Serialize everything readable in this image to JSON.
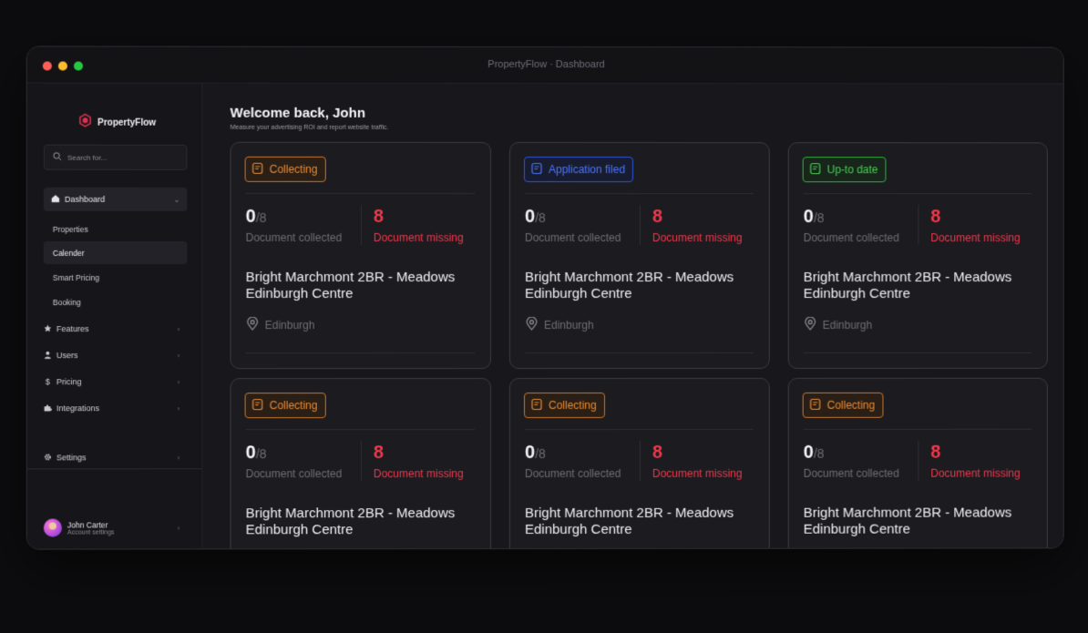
{
  "window": {
    "title": "PropertyFlow · Dashboard"
  },
  "sidebar": {
    "brand": "PropertyFlow",
    "search_placeholder": "Search for...",
    "dashboard_label": "Dashboard",
    "sub_items": [
      {
        "label": "Properties"
      },
      {
        "label": "Calender",
        "active": true
      },
      {
        "label": "Smart Pricing"
      },
      {
        "label": "Booking"
      }
    ],
    "nav_items": [
      {
        "label": "Features",
        "icon": "star-icon"
      },
      {
        "label": "Users",
        "icon": "user-icon"
      },
      {
        "label": "Pricing",
        "icon": "dollar-icon"
      },
      {
        "label": "Integrations",
        "icon": "puzzle-icon"
      }
    ],
    "settings_label": "Settings",
    "user": {
      "name": "John Carter",
      "subtitle": "Account settings"
    }
  },
  "main": {
    "welcome": "Welcome back, John",
    "subtitle": "Measure your advertising ROI and report website traffic."
  },
  "cards": [
    {
      "status": "Collecting",
      "collected": "0",
      "total": "/8",
      "collected_label": "Document collected",
      "missing": "8",
      "missing_label": "Document missing",
      "title": "Bright Marchmont 2BR - Meadows Edinburgh Centre",
      "location": "Edinburgh"
    },
    {
      "status": "Application filed",
      "collected": "0",
      "total": "/8",
      "collected_label": "Document collected",
      "missing": "8",
      "missing_label": "Document missing",
      "title": "Bright Marchmont 2BR - Meadows Edinburgh Centre",
      "location": "Edinburgh"
    },
    {
      "status": "Up-to date",
      "collected": "0",
      "total": "/8",
      "collected_label": "Document collected",
      "missing": "8",
      "missing_label": "Document missing",
      "title": "Bright Marchmont 2BR - Meadows Edinburgh Centre",
      "location": "Edinburgh"
    },
    {
      "status": "Collecting",
      "collected": "0",
      "total": "/8",
      "collected_label": "Document collected",
      "missing": "8",
      "missing_label": "Document missing",
      "title": "Bright Marchmont 2BR - Meadows Edinburgh Centre"
    },
    {
      "status": "Collecting",
      "collected": "0",
      "total": "/8",
      "collected_label": "Document collected",
      "missing": "8",
      "missing_label": "Document missing",
      "title": "Bright Marchmont 2BR - Meadows Edinburgh Centre"
    },
    {
      "status": "Collecting",
      "collected": "0",
      "total": "/8",
      "collected_label": "Document collected",
      "missing": "8",
      "missing_label": "Document missing",
      "title": "Bright Marchmont 2BR - Meadows Edinburgh Centre"
    }
  ],
  "colors": {
    "collecting": "#e98a34",
    "application_filed": "#4c74ff",
    "up_to_date": "#44d24f",
    "missing": "#f0384b"
  }
}
